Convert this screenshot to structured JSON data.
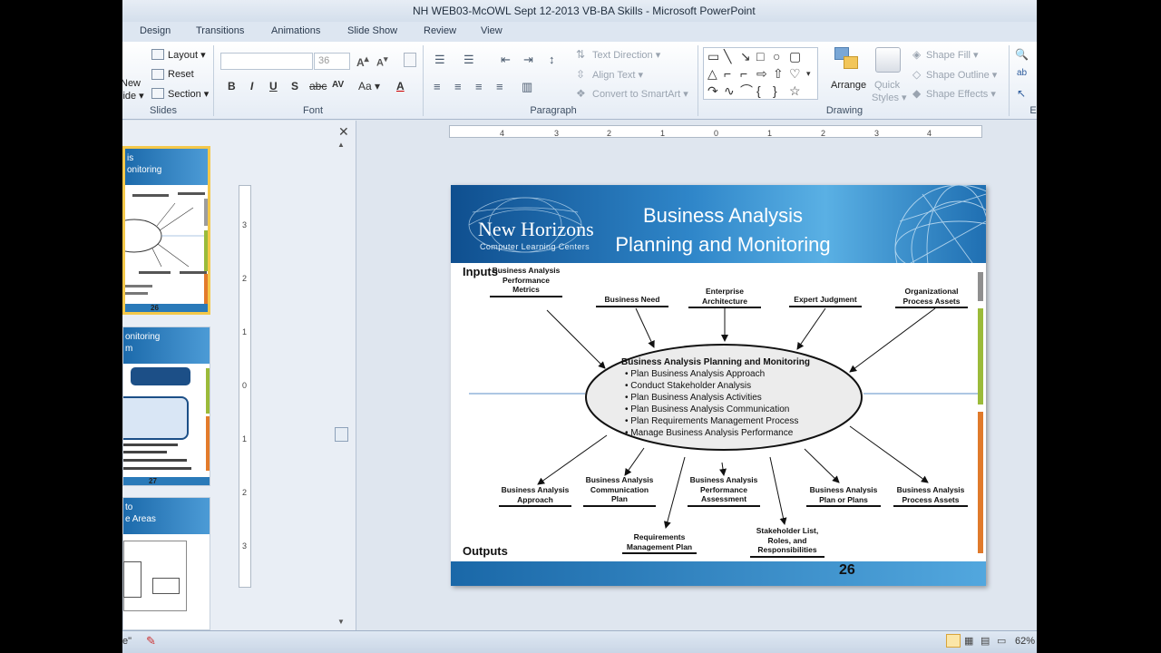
{
  "window": {
    "title": "NH WEB03-McOWL Sept 12-2013 VB-BA Skills  -  Microsoft PowerPoint"
  },
  "tabs": [
    "Design",
    "Transitions",
    "Animations",
    "Slide Show",
    "Review",
    "View"
  ],
  "ribbon": {
    "slides": {
      "label": "Slides",
      "new_slide": "New",
      "new_slide2": "lide ▾",
      "layout": "Layout ▾",
      "reset": "Reset",
      "section": "Section ▾"
    },
    "font": {
      "label": "Font",
      "size": "36",
      "bold": "B",
      "italic": "I",
      "underline": "U",
      "shadow": "S",
      "strike": "abc",
      "aa": "Aa ▾",
      "spacing": "AV"
    },
    "paragraph": {
      "label": "Paragraph",
      "text_direction": "Text Direction ▾",
      "align_text": "Align Text ▾",
      "convert": "Convert to SmartArt ▾"
    },
    "drawing": {
      "label": "Drawing",
      "arrange": "Arrange",
      "quick_styles": "Quick",
      "quick_styles2": "Styles ▾",
      "shape_fill": "Shape Fill ▾",
      "shape_outline": "Shape Outline ▾",
      "shape_effects": "Shape Effects ▾"
    },
    "editing": {
      "label": "E"
    }
  },
  "thumbnails": [
    {
      "title_line1": "is",
      "title_line2": "onitoring",
      "number": "26"
    },
    {
      "title_line1": "onitoring",
      "title_line2": "m",
      "number": "27"
    },
    {
      "title_line1": "to",
      "title_line2": "e Areas"
    }
  ],
  "slide": {
    "logo": "New Horizons",
    "logo_sub": "Computer Learning Centers",
    "title_line1": "Business Analysis",
    "title_line2": "Planning and Monitoring",
    "inputs_label": "Inputs",
    "outputs_label": "Outputs",
    "page_number": "26",
    "inputs": [
      "Business Analysis Performance Metrics",
      "Business Need",
      "Enterprise Architecture",
      "Expert Judgment",
      "Organizational Process Assets"
    ],
    "center_title": "Business Analysis Planning and Monitoring",
    "center_items": [
      "• Plan Business Analysis Approach",
      "• Conduct Stakeholder Analysis",
      "• Plan Business Analysis Activities",
      "• Plan Business Analysis Communication",
      "• Plan Requirements Management Process",
      "• Manage Business Analysis Performance"
    ],
    "outputs": [
      "Business Analysis Approach",
      "Business Analysis Communication Plan",
      "Requirements Management Plan",
      "Business Analysis Performance Assessment",
      "Stakeholder List, Roles, and Responsibilities",
      "Business Analysis Plan or Plans",
      "Business Analysis Process Assets"
    ]
  },
  "statusbar": {
    "zoom": "62%"
  }
}
